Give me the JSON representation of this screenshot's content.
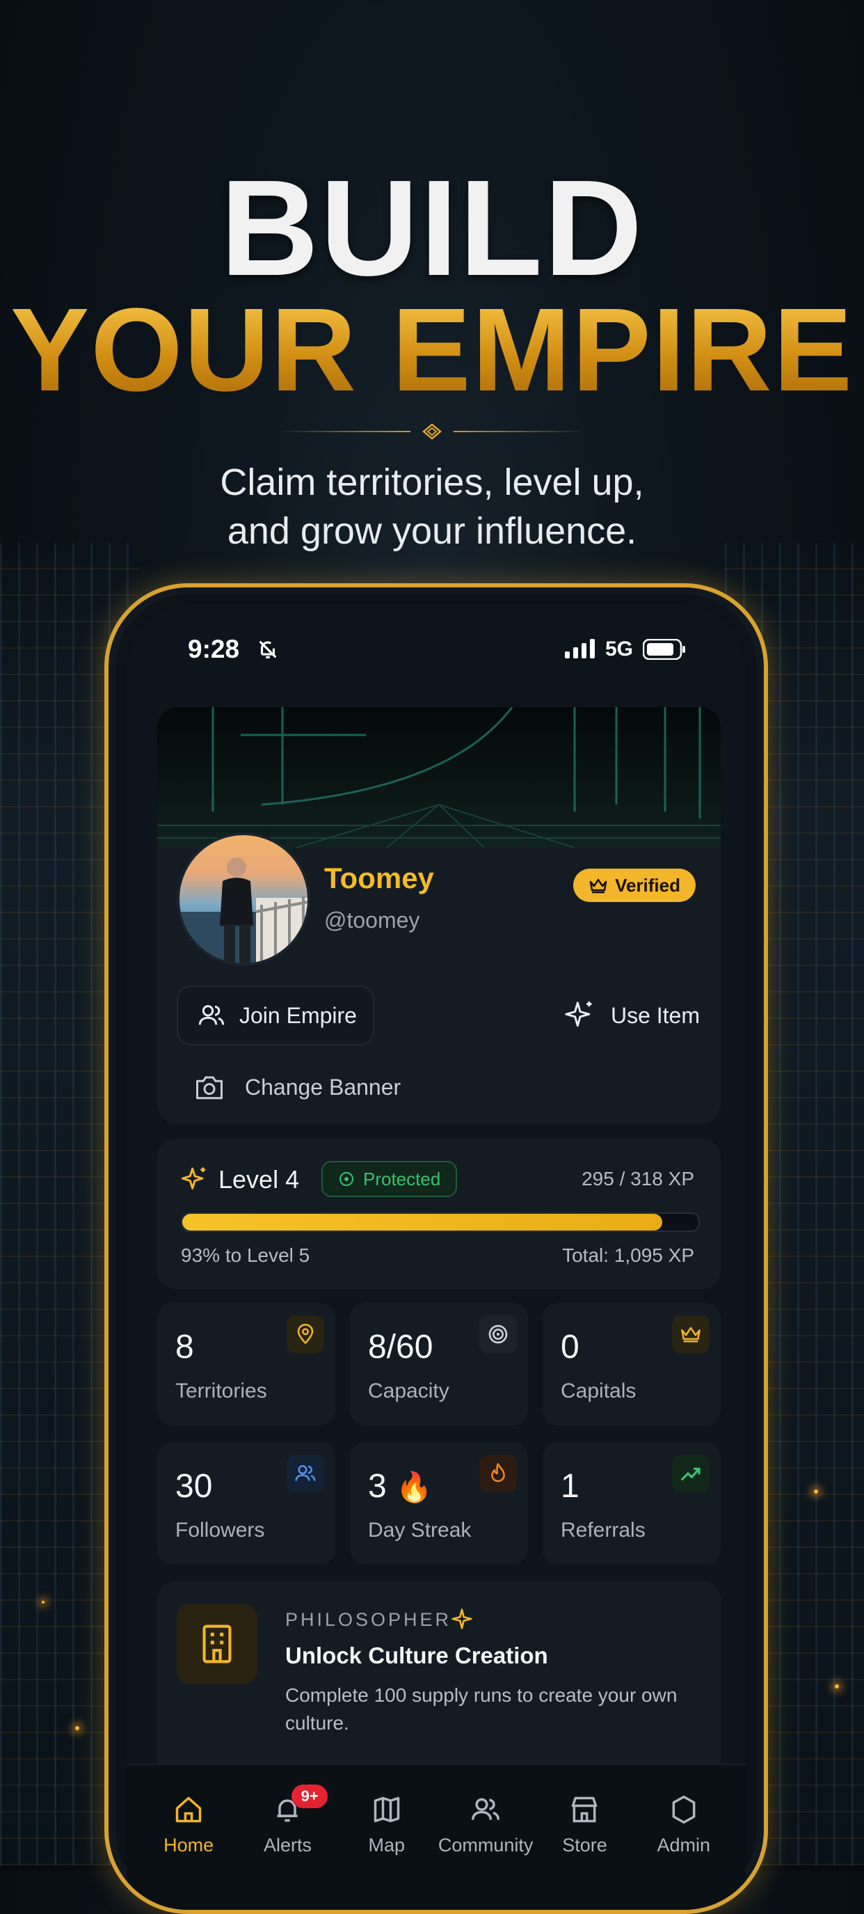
{
  "hero": {
    "line1": "BUILD",
    "line2": "YOUR EMPIRE",
    "tagline_1": "Claim territories, level up,",
    "tagline_2": "and grow your influence."
  },
  "status_bar": {
    "time": "9:28",
    "network": "5G"
  },
  "profile": {
    "name": "Toomey",
    "handle": "@toomey",
    "verified_label": "Verified",
    "join_label": "Join Empire",
    "use_item_label": "Use Item",
    "change_banner_label": "Change Banner"
  },
  "level": {
    "title": "Level 4",
    "protected_label": "Protected",
    "xp_readout": "295 / 318 XP",
    "progress_fraction": 0.93,
    "next_label": "93% to Level 5",
    "total_label": "Total: 1,095 XP"
  },
  "stats": [
    {
      "value": "8",
      "label": "Territories",
      "icon": "map-pin-icon",
      "color": "#f3b52a",
      "bg": "#2a2412"
    },
    {
      "value": "8/60",
      "label": "Capacity",
      "icon": "target-icon",
      "color": "#c9d0d7",
      "bg": "#1c232b"
    },
    {
      "value": "0",
      "label": "Capitals",
      "icon": "crown-icon",
      "color": "#f3b52a",
      "bg": "#2a2412"
    },
    {
      "value": "30",
      "label": "Followers",
      "icon": "users-icon",
      "color": "#4f8fe8",
      "bg": "#142236"
    },
    {
      "value": "3",
      "emoji": "🔥",
      "label": "Day Streak",
      "icon": "flame-icon",
      "color": "#f08a2a",
      "bg": "#2c1c12"
    },
    {
      "value": "1",
      "label": "Referrals",
      "icon": "trend-up-icon",
      "color": "#3ec26b",
      "bg": "#12281b"
    }
  ],
  "unlock": {
    "kicker": "PHILOSOPHER",
    "title": "Unlock Culture Creation",
    "description": "Complete 100 supply runs to create your own culture."
  },
  "tabs": [
    {
      "label": "Home",
      "icon": "home-icon",
      "active": true
    },
    {
      "label": "Alerts",
      "icon": "bell-icon",
      "badge": "9+"
    },
    {
      "label": "Map",
      "icon": "map-icon"
    },
    {
      "label": "Community",
      "icon": "users-icon"
    },
    {
      "label": "Store",
      "icon": "store-icon"
    },
    {
      "label": "Admin",
      "icon": "shield-icon"
    }
  ],
  "colors": {
    "accent": "#f3b52a",
    "protected": "#36c26d",
    "alert": "#e52230"
  }
}
